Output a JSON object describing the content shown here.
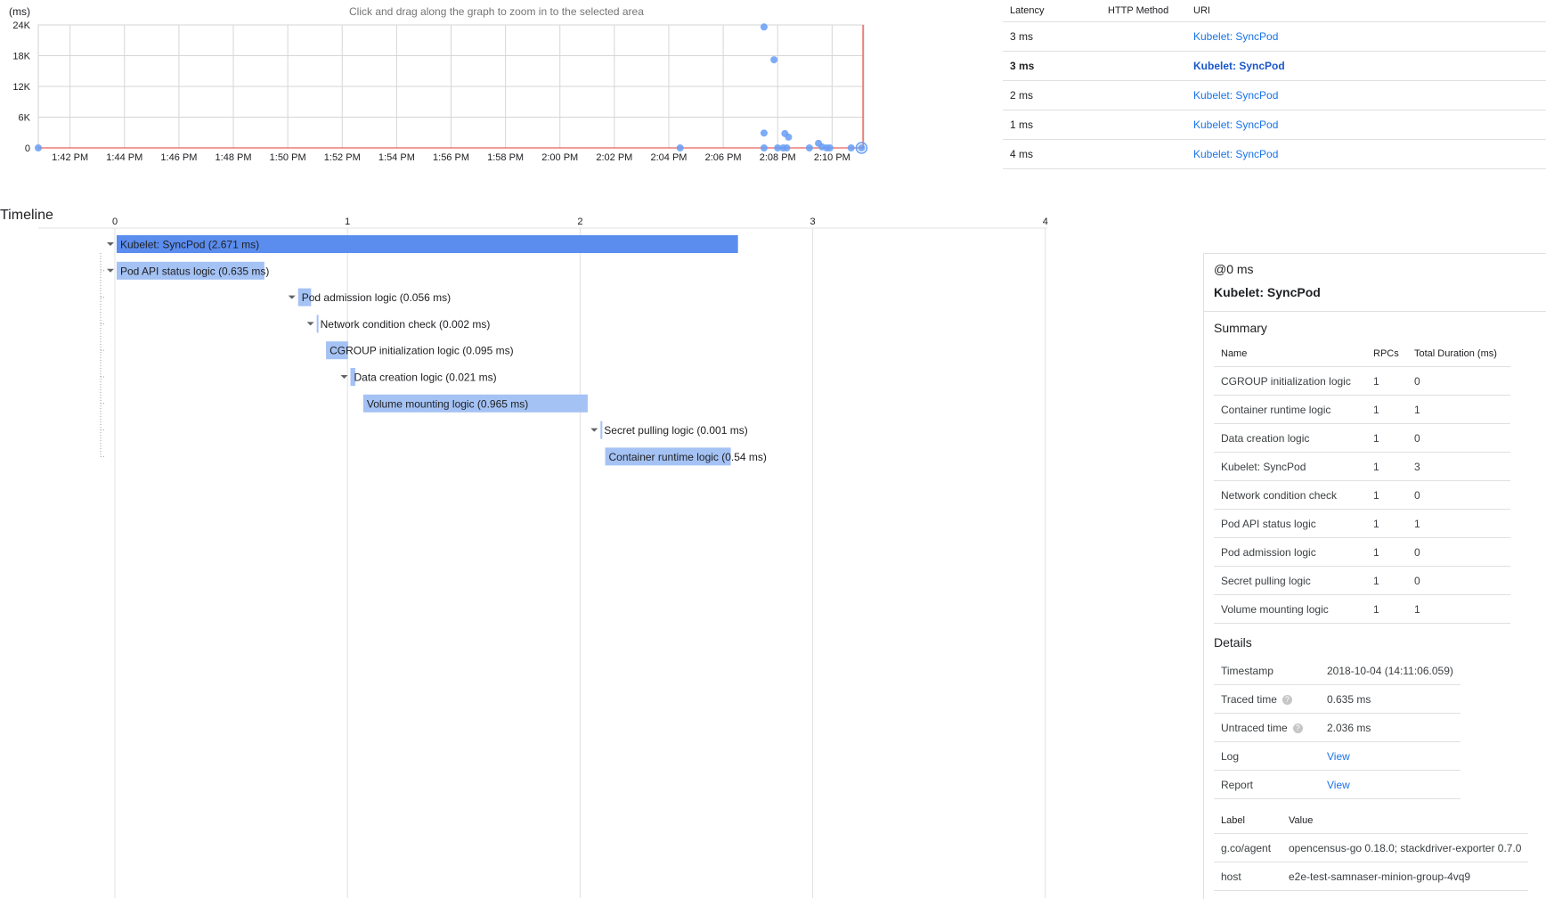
{
  "chart": {
    "unit_label": "(ms)",
    "hint": "Click and drag along the graph to zoom in to the selected area",
    "accent_color": "#669df6",
    "marker_color": "#e53935"
  },
  "chart_data": {
    "type": "scatter",
    "title": "",
    "ylabel": "(ms)",
    "ylim": [
      0,
      24000
    ],
    "y_ticks": [
      "24K",
      "18K",
      "12K",
      "6K",
      "0"
    ],
    "y_tick_values": [
      24000,
      18000,
      12000,
      6000,
      0
    ],
    "x_ticks": [
      "1:42 PM",
      "1:44 PM",
      "1:46 PM",
      "1:48 PM",
      "1:50 PM",
      "1:52 PM",
      "1:54 PM",
      "1:56 PM",
      "1:58 PM",
      "2:00 PM",
      "2:02 PM",
      "2:04 PM",
      "2:06 PM",
      "2:08 PM",
      "2:10 PM"
    ],
    "xlim_minutes": [
      "1:40:50 PM",
      "2:11:10 PM"
    ],
    "series": [
      {
        "x": [
          "1:40:50 PM",
          "2:04:25 PM",
          "2:07:30 PM",
          "2:07:30 PM",
          "2:07:30 PM",
          "2:07:52 PM",
          "2:08:16 PM",
          "2:08:24 PM",
          "2:08:00 PM",
          "2:08:12 PM",
          "2:08:20 PM",
          "2:09:10 PM",
          "2:09:30 PM",
          "2:09:38 PM",
          "2:09:48 PM",
          "2:09:55 PM",
          "2:10:42 PM",
          "2:11:05 PM"
        ],
        "y": [
          0,
          0,
          23600,
          2900,
          0,
          17200,
          2800,
          2100,
          0,
          0,
          0,
          0,
          900,
          200,
          0,
          0,
          0,
          0
        ]
      }
    ],
    "grid": true,
    "selected_point": {
      "x": "2:11:05 PM",
      "y": 0
    }
  },
  "trace_list": {
    "headers": [
      "Latency",
      "HTTP Method",
      "URI"
    ],
    "rows": [
      {
        "latency": "3 ms",
        "method": "",
        "uri": "Kubelet: SyncPod"
      },
      {
        "latency": "3 ms",
        "method": "",
        "uri": "Kubelet: SyncPod"
      },
      {
        "latency": "2 ms",
        "method": "",
        "uri": "Kubelet: SyncPod"
      },
      {
        "latency": "1 ms",
        "method": "",
        "uri": "Kubelet: SyncPod"
      },
      {
        "latency": "4 ms",
        "method": "",
        "uri": "Kubelet: SyncPod"
      }
    ]
  },
  "timeline": {
    "title": "Timeline",
    "ticks": [
      "0",
      "1",
      "2",
      "3",
      "4"
    ],
    "tick_values": [
      0,
      1,
      2,
      3,
      4
    ],
    "colors": {
      "root": "#5b8def",
      "child": "#a4c2f4"
    },
    "spans": [
      {
        "label": "Kubelet: SyncPod (2.671 ms)",
        "start": 0.0,
        "dur": 2.671,
        "depth": 0,
        "collapsible": true
      },
      {
        "label": "Pod API status logic (0.635 ms)",
        "start": 0.0,
        "dur": 0.635,
        "depth": 1,
        "collapsible": true
      },
      {
        "label": "Pod admission logic (0.056 ms)",
        "start": 0.78,
        "dur": 0.056,
        "depth": 2,
        "collapsible": true
      },
      {
        "label": "Network condition check (0.002 ms)",
        "start": 0.86,
        "dur": 0.002,
        "depth": 3,
        "collapsible": true
      },
      {
        "label": "CGROUP initialization logic (0.095 ms)",
        "start": 0.9,
        "dur": 0.095,
        "depth": 4,
        "collapsible": false
      },
      {
        "label": "Data creation logic (0.021 ms)",
        "start": 1.005,
        "dur": 0.021,
        "depth": 5,
        "collapsible": true
      },
      {
        "label": "Volume mounting logic (0.965 ms)",
        "start": 1.06,
        "dur": 0.965,
        "depth": 6,
        "collapsible": false
      },
      {
        "label": "Secret pulling logic (0.001 ms)",
        "start": 2.08,
        "dur": 0.001,
        "depth": 7,
        "collapsible": true
      },
      {
        "label": "Container runtime logic (0.54 ms)",
        "start": 2.1,
        "dur": 0.54,
        "depth": 8,
        "collapsible": false
      }
    ]
  },
  "details": {
    "offset": "@0 ms",
    "span_name": "Kubelet: SyncPod",
    "summary_title": "Summary",
    "summary_headers": [
      "Name",
      "RPCs",
      "Total Duration (ms)"
    ],
    "summary_rows": [
      [
        "CGROUP initialization logic",
        "1",
        "0"
      ],
      [
        "Container runtime logic",
        "1",
        "1"
      ],
      [
        "Data creation logic",
        "1",
        "0"
      ],
      [
        "Kubelet: SyncPod",
        "1",
        "3"
      ],
      [
        "Network condition check",
        "1",
        "0"
      ],
      [
        "Pod API status logic",
        "1",
        "1"
      ],
      [
        "Pod admission logic",
        "1",
        "0"
      ],
      [
        "Secret pulling logic",
        "1",
        "0"
      ],
      [
        "Volume mounting logic",
        "1",
        "1"
      ]
    ],
    "details_title": "Details",
    "timestamp_label": "Timestamp",
    "timestamp_value": "2018-10-04 (14:11:06.059)",
    "traced_label": "Traced time",
    "traced_value": "0.635 ms",
    "untraced_label": "Untraced time",
    "untraced_value": "2.036 ms",
    "log_label": "Log",
    "log_link": "View",
    "report_label": "Report",
    "report_link": "View",
    "labels_headers": [
      "Label",
      "Value"
    ],
    "label_rows": [
      [
        "g.co/agent",
        "opencensus-go 0.18.0; stackdriver-exporter 0.7.0"
      ],
      [
        "host",
        "e2e-test-samnaser-minion-group-4vq9"
      ]
    ]
  }
}
